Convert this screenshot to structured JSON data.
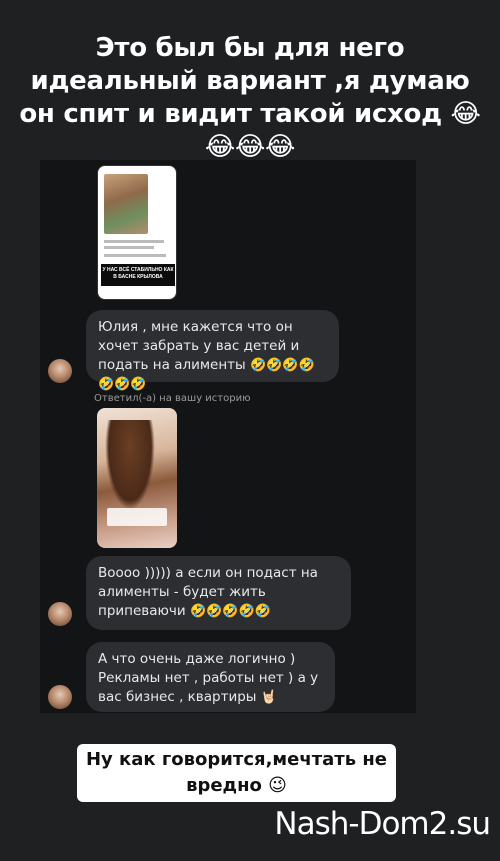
{
  "top_caption": "Это был бы для него идеальный вариант ,я думаю он спит и видит  такой исход 😂😂😂😂",
  "chat": {
    "message1": {
      "text": "Юлия , мне кажется что он хочет забрать у вас детей и подать на алименты",
      "emojis": "🤣🤣🤣🤣🤣🤣🤣"
    },
    "reply_note": "Ответил(-а) на вашу историю",
    "message2": {
      "text": "Воооо ))))) а если он подаст на алименты - будет жить припеваючи",
      "emojis": "🤣🤣🤣🤣🤣"
    },
    "message3": {
      "text": "А что очень даже логично ) Рекламы нет , работы нет ) а у вас бизнес , квартиры",
      "emojis": "🤘🏻"
    },
    "thumb1_banner": "У НАС ВСЁ СТАБИЛЬНО КАК В БАСНЕ КРЫЛОВА"
  },
  "bottom_caption": {
    "line1": "Ну как говорится,мечтать не",
    "line2": "вредно 😉"
  },
  "watermark": "Nash-Dom2.su"
}
